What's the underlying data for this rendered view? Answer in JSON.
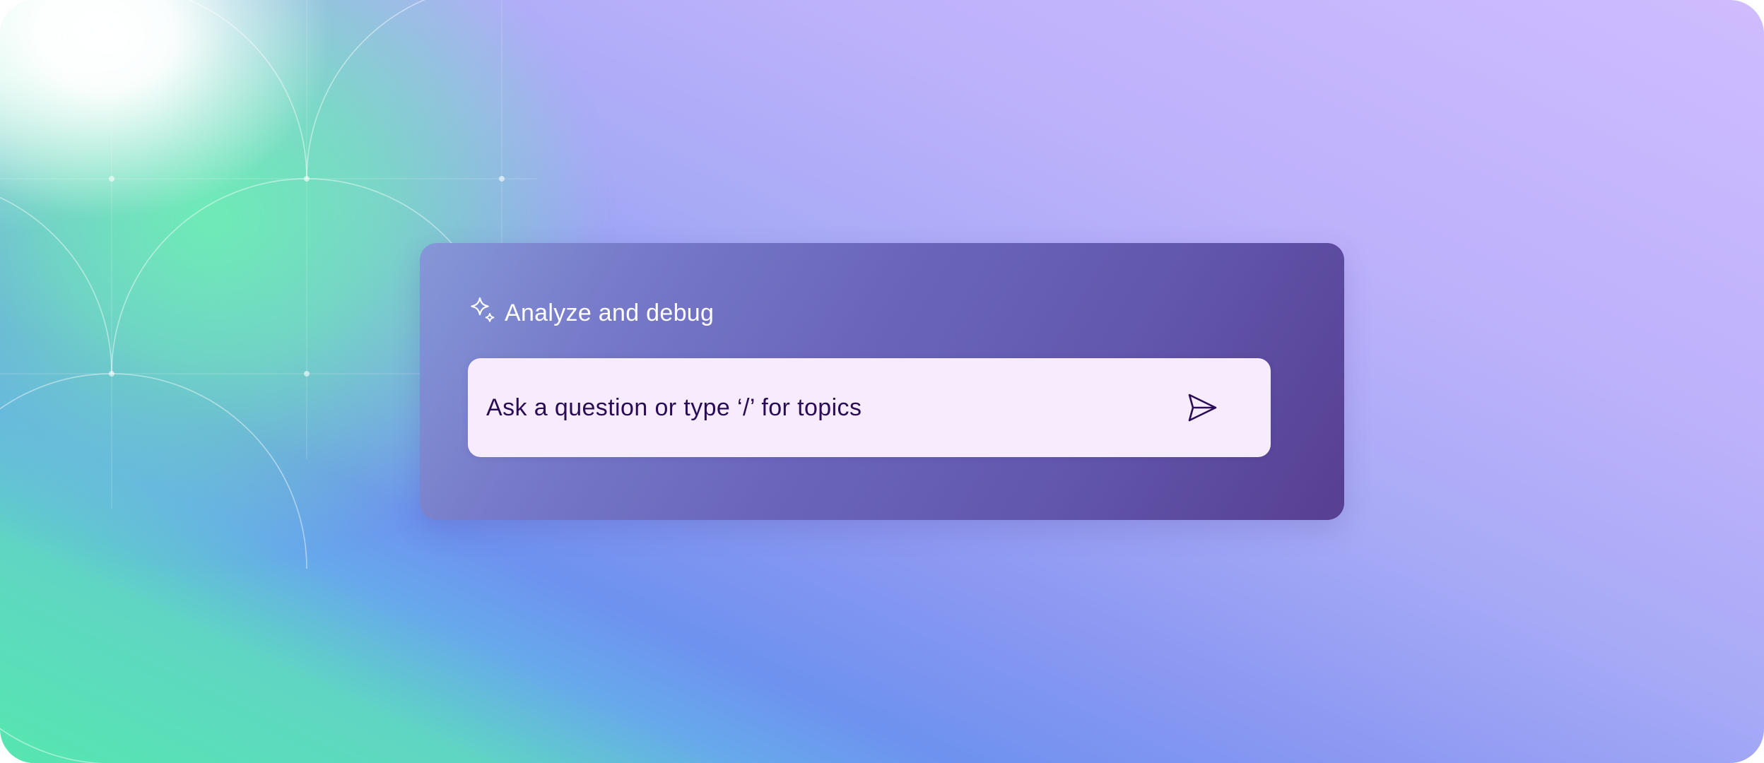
{
  "header": {
    "icon": "sparkle-icon",
    "title": "Analyze and debug"
  },
  "prompt": {
    "placeholder": "Ask a question or type ‘/’ for topics",
    "send_icon": "send-icon"
  },
  "colors": {
    "title_text": "#ffffff",
    "prompt_text": "#2a0c56",
    "prompt_background": "#f6ecfd",
    "card_start": "#8598d8",
    "card_end": "#573f92"
  }
}
